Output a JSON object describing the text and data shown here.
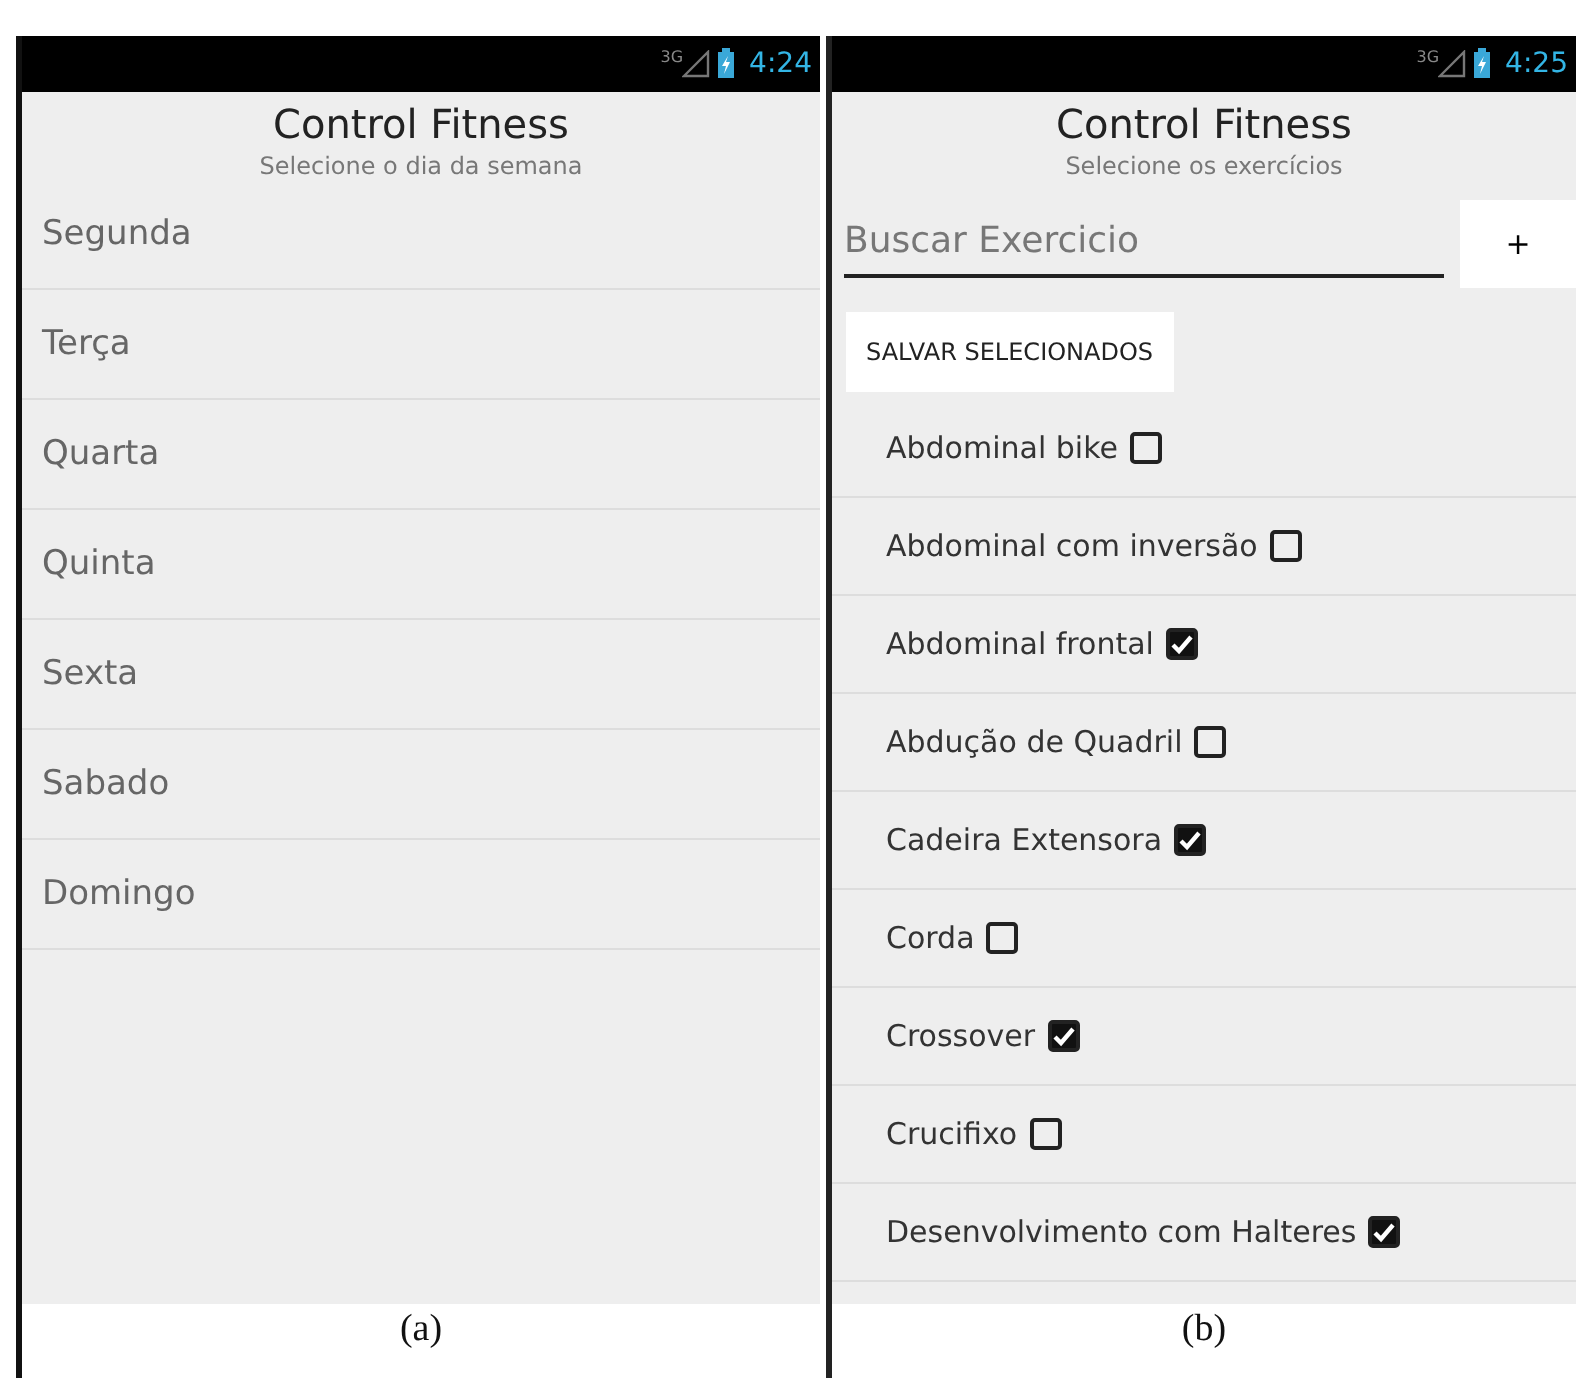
{
  "screens": [
    {
      "status_bar": {
        "network": "3G",
        "time": "4:24"
      },
      "title": "Control Fitness",
      "subtitle": "Selecione o dia da semana",
      "kind": "days",
      "days": [
        "Segunda",
        "Terça",
        "Quarta",
        "Quinta",
        "Sexta",
        "Sabado",
        "Domingo"
      ],
      "caption": "(a)"
    },
    {
      "status_bar": {
        "network": "3G",
        "time": "4:25"
      },
      "title": "Control Fitness",
      "subtitle": "Selecione os exercícios",
      "kind": "exercises",
      "search": {
        "placeholder": "Buscar Exercicio"
      },
      "add_button": "+",
      "save_button": "SALVAR SELECIONADOS",
      "exercises": [
        {
          "label": "Abdominal bike",
          "checked": false
        },
        {
          "label": "Abdominal com inversão",
          "checked": false
        },
        {
          "label": "Abdominal frontal",
          "checked": true
        },
        {
          "label": "Abdução de Quadril",
          "checked": false
        },
        {
          "label": "Cadeira Extensora",
          "checked": true
        },
        {
          "label": "Corda",
          "checked": false
        },
        {
          "label": "Crossover",
          "checked": true
        },
        {
          "label": "Crucifixo",
          "checked": false
        },
        {
          "label": "Desenvolvimento com Halteres",
          "checked": true
        }
      ],
      "caption": "(b)"
    }
  ]
}
